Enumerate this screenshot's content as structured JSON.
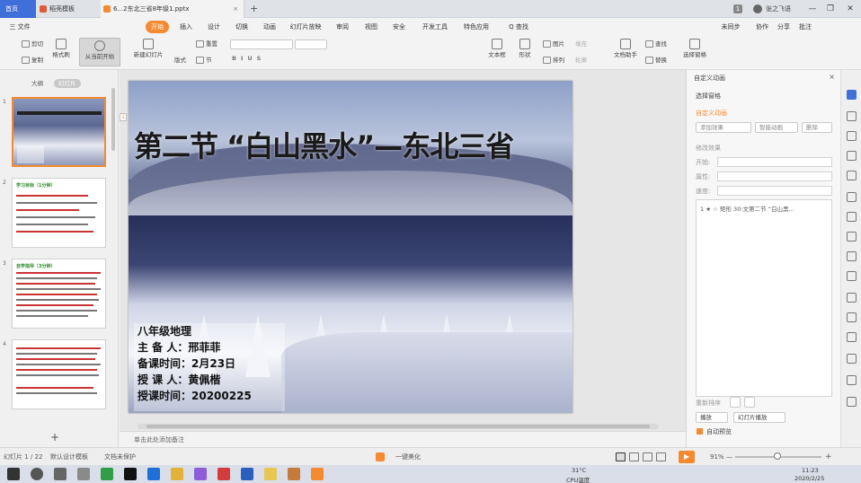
{
  "tabs": {
    "home": "首页",
    "template": "稻壳模板",
    "document": "6...2东北三省8年级1.pptx",
    "close": "×",
    "new_tab": "+"
  },
  "titlebar_right": {
    "badge": "1",
    "user": "张之飞语",
    "min": "—",
    "restore": "❐",
    "close": "✕"
  },
  "menu": {
    "file": "三 文件",
    "items": [
      "开始",
      "插入",
      "设计",
      "切换",
      "动画",
      "幻灯片放映",
      "审阅",
      "视图",
      "安全",
      "开发工具",
      "特色应用"
    ],
    "active_index": 0,
    "search": "Q 查找",
    "sync": "未同步",
    "collab": "协作",
    "share": "分享",
    "comment": "批注"
  },
  "ribbon": {
    "cut": "剪切",
    "copy": "复制",
    "paste": "粘贴",
    "format_painter": "格式刷",
    "from_current": "从当前开始",
    "new_slide": "新建幻灯片",
    "layout": "版式",
    "section": "节",
    "reset": "重置",
    "textbox": "文本框",
    "shape": "形状",
    "arrange": "排列",
    "picture": "图片",
    "fill": "填充",
    "outline": "轮廓",
    "text_assistant": "文档助手",
    "find": "查找",
    "replace": "替换",
    "select_pane": "选择窗格"
  },
  "left_panel": {
    "outline_tab": "大纲",
    "slides_tab": "幻灯片",
    "add": "+"
  },
  "thumbs": [
    {
      "num": "1",
      "title": ""
    },
    {
      "num": "2",
      "title": "学习目标（1分钟）"
    },
    {
      "num": "3",
      "title": "自学指导（3分钟）"
    },
    {
      "num": "4",
      "title": ""
    }
  ],
  "slide": {
    "badge": "1",
    "title": "第二节 “白山黑水”—东北三省",
    "info": [
      "八年级地理",
      "主 备 人：邢菲菲",
      "备课时间：2月23日",
      "授 课 人：黄佩楷",
      "授课时间：20200225"
    ]
  },
  "notes_placeholder": "单击此处添加备注",
  "task_pane": {
    "header": "自定义动画",
    "select_pane": "选择窗格",
    "custom_anim": "自定义动画",
    "add_effect": "添加效果",
    "smart_anim": "智能动画",
    "delete": "删除",
    "modify": "修改效果",
    "start_label": "开始:",
    "property_label": "属性:",
    "speed_label": "速度:",
    "list_item": "1 ★ ☆ 矩形 30:文第二节 “白山黑...",
    "reorder": "重新排序",
    "play": "播放",
    "slideshow": "幻灯片播放",
    "auto_preview": "自动预览",
    "close": "×"
  },
  "status": {
    "slide_counter": "幻灯片 1 / 22",
    "theme": "默认设计模板",
    "missing_font": "文档未保护",
    "beautify": "一键美化",
    "zoom": "91%",
    "zoom_minus": "—",
    "zoom_plus": "+"
  },
  "taskbar": {
    "weather": "31°C",
    "weather2": "CPU温度",
    "time": "11:23",
    "date": "2020/2/25"
  },
  "colors": {
    "accent": "#f58a30",
    "home_tab": "#3f6fd8"
  }
}
